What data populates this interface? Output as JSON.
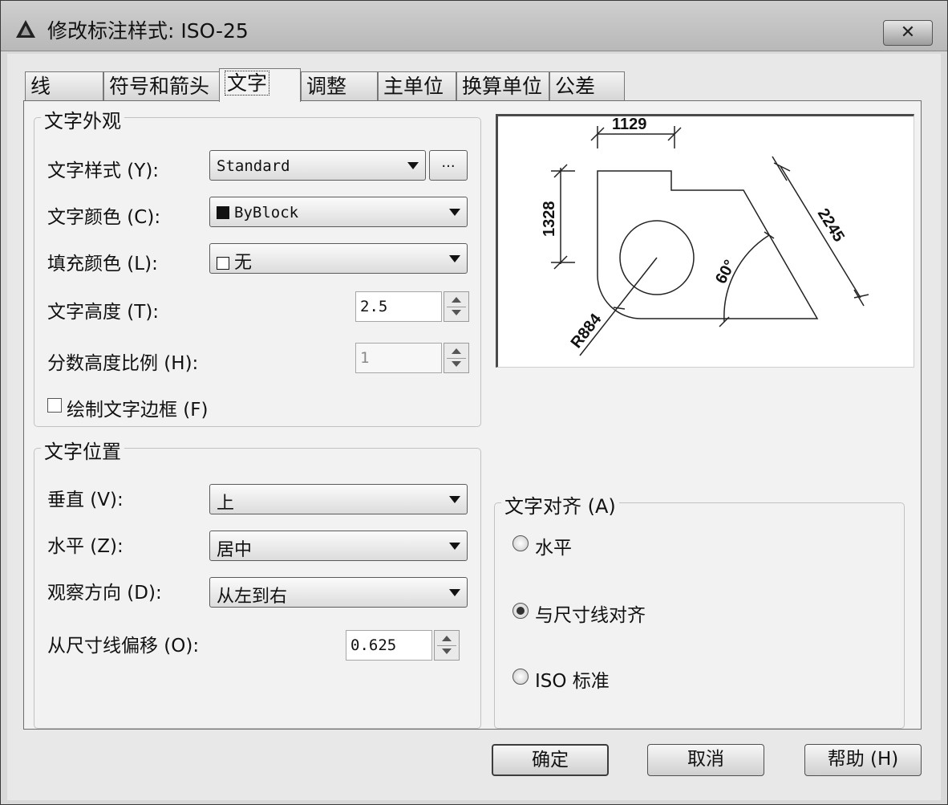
{
  "window": {
    "title": "修改标注样式: ISO-25",
    "close_label": "✕"
  },
  "tabs": [
    {
      "label": "线"
    },
    {
      "label": "符号和箭头"
    },
    {
      "label": "文字",
      "active": true
    },
    {
      "label": "调整"
    },
    {
      "label": "主单位"
    },
    {
      "label": "换算单位"
    },
    {
      "label": "公差"
    }
  ],
  "text_appearance": {
    "group_title": "文字外观",
    "style_label": "文字样式 (Y):",
    "style_value": "Standard",
    "browse_label": "...",
    "color_label": "文字颜色 (C):",
    "color_value": "ByBlock",
    "fill_label": "填充颜色 (L):",
    "fill_value": "无",
    "height_label": "文字高度 (T):",
    "height_value": "2.5",
    "fraction_label": "分数高度比例 (H):",
    "fraction_value": "1",
    "frame_label": "绘制文字边框 (F)",
    "frame_checked": false
  },
  "text_placement": {
    "group_title": "文字位置",
    "vertical_label": "垂直 (V):",
    "vertical_value": "上",
    "horizontal_label": "水平 (Z):",
    "horizontal_value": "居中",
    "direction_label": "观察方向 (D):",
    "direction_value": "从左到右",
    "offset_label": "从尺寸线偏移 (O):",
    "offset_value": "0.625"
  },
  "text_alignment": {
    "group_title": "文字对齐 (A)",
    "options": [
      {
        "label": "水平",
        "selected": false
      },
      {
        "label": "与尺寸线对齐",
        "selected": true
      },
      {
        "label": "ISO 标准",
        "selected": false
      }
    ]
  },
  "preview": {
    "dim_top": "1129",
    "dim_left": "1328",
    "dim_right": "2245",
    "dim_radius": "R884",
    "dim_angle": "60°"
  },
  "buttons": {
    "ok": "确定",
    "cancel": "取消",
    "help": "帮助 (H)"
  }
}
